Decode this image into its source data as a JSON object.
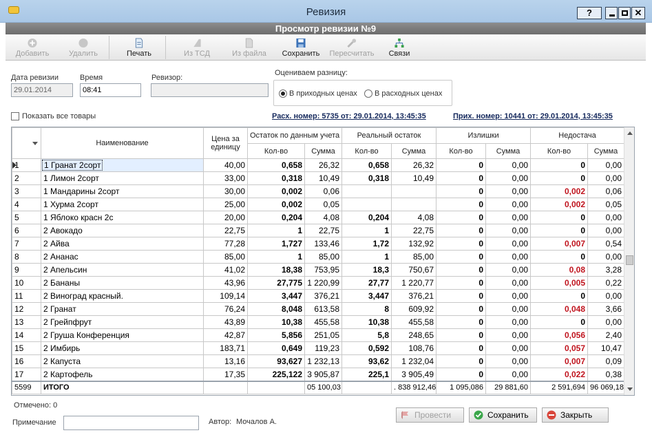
{
  "window": {
    "title": "Ревизия",
    "help": "?"
  },
  "subheader": "Просмотр ревизии №9",
  "toolbar": [
    {
      "id": "add",
      "label": "Добавить",
      "icon": "plus-icon",
      "enabled": false
    },
    {
      "id": "delete",
      "label": "Удалить",
      "icon": "delete-icon",
      "enabled": false
    },
    {
      "id": "print",
      "label": "Печать",
      "icon": "print-icon",
      "enabled": true
    },
    {
      "id": "from-tsd",
      "label": "Из ТСД",
      "icon": "tsd-icon",
      "enabled": false
    },
    {
      "id": "from-file",
      "label": "Из файла",
      "icon": "file-icon",
      "enabled": false
    },
    {
      "id": "save",
      "label": "Сохранить",
      "icon": "save-icon",
      "enabled": true
    },
    {
      "id": "recalc",
      "label": "Пересчитать",
      "icon": "recalc-icon",
      "enabled": false
    },
    {
      "id": "links",
      "label": "Связи",
      "icon": "links-icon",
      "enabled": true
    }
  ],
  "form": {
    "date_label": "Дата ревизии",
    "date_value": "29.01.2014",
    "time_label": "Время",
    "time_value": "08:41",
    "auditor_label": "Ревизор:",
    "auditor_value": "",
    "eval_label": "Оцениваем разницу:",
    "radio_income": "В приходных ценах",
    "radio_expense": "В расходных ценах",
    "show_all_label": "Показать все товары",
    "expense_link": "Расх. номер: 5735 от: 29.01.2014, 13:45:35",
    "income_link": "Прих. номер: 10441 от: 29.01.2014, 13:45:35"
  },
  "grid": {
    "headers": {
      "name": "Наименование",
      "price": "Цена за единицу",
      "stock_acc": "Остаток по данным учета",
      "stock_real": "Реальный остаток",
      "surplus": "Излишки",
      "shortage": "Недостача",
      "qty": "Кол-во",
      "sum": "Сумма"
    },
    "rows": [
      {
        "n": "1",
        "name": "1 Гранат 2сорт",
        "price": "40,00",
        "acc_qty": "0,658",
        "acc_sum": "26,32",
        "real_qty": "0,658",
        "real_sum": "26,32",
        "sur_qty": "0",
        "sur_sum": "0,00",
        "sh_qty": "0",
        "sh_sum": "0,00"
      },
      {
        "n": "2",
        "name": "1 Лимон 2сорт",
        "price": "33,00",
        "acc_qty": "0,318",
        "acc_sum": "10,49",
        "real_qty": "0,318",
        "real_sum": "10,49",
        "sur_qty": "0",
        "sur_sum": "0,00",
        "sh_qty": "0",
        "sh_sum": "0,00"
      },
      {
        "n": "3",
        "name": "1 Мандарины 2сорт",
        "price": "30,00",
        "acc_qty": "0,002",
        "acc_sum": "0,06",
        "real_qty": "",
        "real_sum": "",
        "sur_qty": "0",
        "sur_sum": "0,00",
        "sh_qty": "0,002",
        "sh_sum": "0,06"
      },
      {
        "n": "4",
        "name": "1 Хурма 2сорт",
        "price": "25,00",
        "acc_qty": "0,002",
        "acc_sum": "0,05",
        "real_qty": "",
        "real_sum": "",
        "sur_qty": "0",
        "sur_sum": "0,00",
        "sh_qty": "0,002",
        "sh_sum": "0,05"
      },
      {
        "n": "5",
        "name": "1 Яблоко красн 2с",
        "price": "20,00",
        "acc_qty": "0,204",
        "acc_sum": "4,08",
        "real_qty": "0,204",
        "real_sum": "4,08",
        "sur_qty": "0",
        "sur_sum": "0,00",
        "sh_qty": "0",
        "sh_sum": "0,00"
      },
      {
        "n": "6",
        "name": "2 Авокадо",
        "price": "22,75",
        "acc_qty": "1",
        "acc_sum": "22,75",
        "real_qty": "1",
        "real_sum": "22,75",
        "sur_qty": "0",
        "sur_sum": "0,00",
        "sh_qty": "0",
        "sh_sum": "0,00"
      },
      {
        "n": "7",
        "name": "2 Айва",
        "price": "77,28",
        "acc_qty": "1,727",
        "acc_sum": "133,46",
        "real_qty": "1,72",
        "real_sum": "132,92",
        "sur_qty": "0",
        "sur_sum": "0,00",
        "sh_qty": "0,007",
        "sh_sum": "0,54"
      },
      {
        "n": "8",
        "name": "2 Ананас",
        "price": "85,00",
        "acc_qty": "1",
        "acc_sum": "85,00",
        "real_qty": "1",
        "real_sum": "85,00",
        "sur_qty": "0",
        "sur_sum": "0,00",
        "sh_qty": "0",
        "sh_sum": "0,00"
      },
      {
        "n": "9",
        "name": "2 Апельсин",
        "price": "41,02",
        "acc_qty": "18,38",
        "acc_sum": "753,95",
        "real_qty": "18,3",
        "real_sum": "750,67",
        "sur_qty": "0",
        "sur_sum": "0,00",
        "sh_qty": "0,08",
        "sh_sum": "3,28"
      },
      {
        "n": "10",
        "name": "2 Бананы",
        "price": "43,96",
        "acc_qty": "27,775",
        "acc_sum": "1 220,99",
        "real_qty": "27,77",
        "real_sum": "1 220,77",
        "sur_qty": "0",
        "sur_sum": "0,00",
        "sh_qty": "0,005",
        "sh_sum": "0,22"
      },
      {
        "n": "11",
        "name": "2 Виноград красный.",
        "price": "109,14",
        "acc_qty": "3,447",
        "acc_sum": "376,21",
        "real_qty": "3,447",
        "real_sum": "376,21",
        "sur_qty": "0",
        "sur_sum": "0,00",
        "sh_qty": "0",
        "sh_sum": "0,00"
      },
      {
        "n": "12",
        "name": "2 Гранат",
        "price": "76,24",
        "acc_qty": "8,048",
        "acc_sum": "613,58",
        "real_qty": "8",
        "real_sum": "609,92",
        "sur_qty": "0",
        "sur_sum": "0,00",
        "sh_qty": "0,048",
        "sh_sum": "3,66"
      },
      {
        "n": "13",
        "name": "2 Грейпфрут",
        "price": "43,89",
        "acc_qty": "10,38",
        "acc_sum": "455,58",
        "real_qty": "10,38",
        "real_sum": "455,58",
        "sur_qty": "0",
        "sur_sum": "0,00",
        "sh_qty": "0",
        "sh_sum": "0,00"
      },
      {
        "n": "14",
        "name": "2 Груша Конференция",
        "price": "42,87",
        "acc_qty": "5,856",
        "acc_sum": "251,05",
        "real_qty": "5,8",
        "real_sum": "248,65",
        "sur_qty": "0",
        "sur_sum": "0,00",
        "sh_qty": "0,056",
        "sh_sum": "2,40"
      },
      {
        "n": "15",
        "name": "2 Имбирь",
        "price": "183,71",
        "acc_qty": "0,649",
        "acc_sum": "119,23",
        "real_qty": "0,592",
        "real_sum": "108,76",
        "sur_qty": "0",
        "sur_sum": "0,00",
        "sh_qty": "0,057",
        "sh_sum": "10,47"
      },
      {
        "n": "16",
        "name": "2 Капуста",
        "price": "13,16",
        "acc_qty": "93,627",
        "acc_sum": "1 232,13",
        "real_qty": "93,62",
        "real_sum": "1 232,04",
        "sur_qty": "0",
        "sur_sum": "0,00",
        "sh_qty": "0,007",
        "sh_sum": "0,09"
      },
      {
        "n": "17",
        "name": "2 Картофель",
        "price": "17,35",
        "acc_qty": "225,122",
        "acc_sum": "3 905,87",
        "real_qty": "225,1",
        "real_sum": "3 905,49",
        "sur_qty": "0",
        "sur_sum": "0,00",
        "sh_qty": "0,022",
        "sh_sum": "0,38"
      }
    ],
    "footer": {
      "count": "5599",
      "label": "итого",
      "acc_sum": "05 100,03",
      "real_sum": ". 838 912,46",
      "sur_qty": "1 095,086",
      "sur_sum": "29 881,60",
      "sh_qty": "2 591,694",
      "sh_sum": "96 069,18"
    }
  },
  "bottom": {
    "marked": "Отмечено: 0",
    "note_label": "Примечание",
    "note_value": "",
    "author_label": "Автор:",
    "author_value": "Мочалов А.",
    "btn_post": "Провести",
    "btn_save": "Сохранить",
    "btn_close": "Закрыть"
  }
}
